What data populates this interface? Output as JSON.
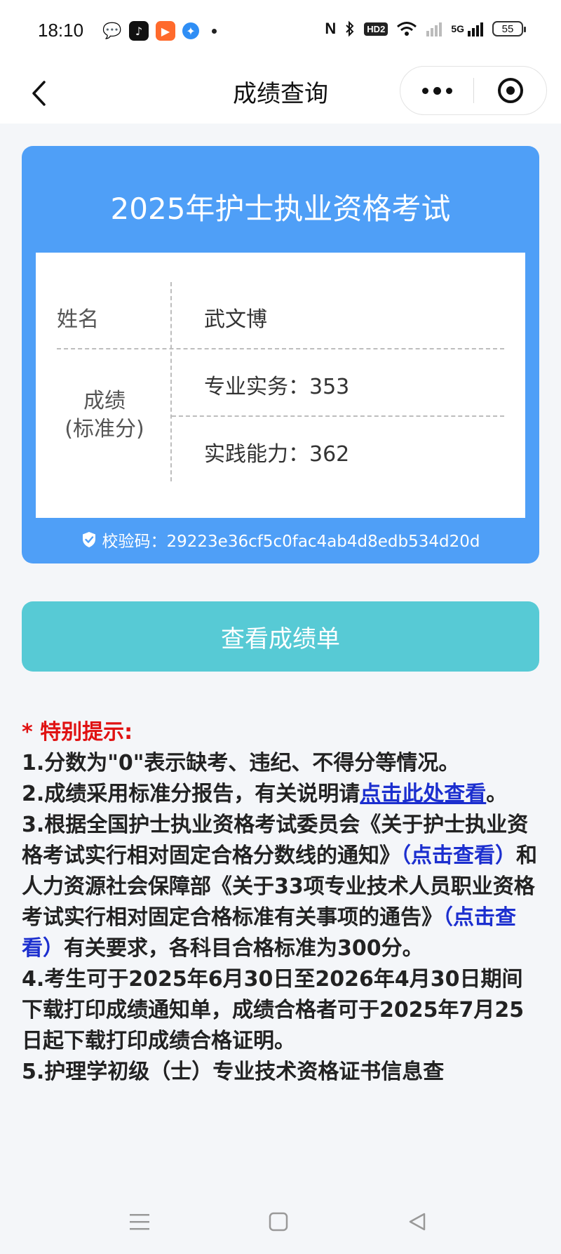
{
  "status_bar": {
    "time": "18:10",
    "battery": "55",
    "hd_label": "HD2",
    "network": "5G",
    "nfc": "N"
  },
  "nav": {
    "title": "成绩查询"
  },
  "card": {
    "title": "2025年护士执业资格考试",
    "name_label": "姓名",
    "name_value": "武文博",
    "score_label_line1": "成绩",
    "score_label_line2": "(标准分)",
    "scores": [
      "专业实务：353",
      "实践能力：362"
    ],
    "verify_text": "校验码：29223e36cf5c0fac4ab4d8edb534d20d"
  },
  "button": {
    "view_report": "查看成绩单"
  },
  "notice": {
    "heading": "* 特别提示:",
    "item1": "1.分数为\"0\"表示缺考、违纪、不得分等情况。",
    "item2_prefix": "2.成绩采用标准分报告，有关说明请",
    "item2_link": "点击此处查看",
    "item2_suffix": "。",
    "item3_part1": "3.根据全国护士执业资格考试委员会《关于护士执业资格考试实行相对固定合格分数线的通知》",
    "item3_link1": "（点击查看）",
    "item3_part2": "和人力资源社会保障部《关于33项专业技术人员职业资格考试实行相对固定合格标准有关事项的通告》",
    "item3_link2": "（点击查看）",
    "item3_part3": "有关要求，各科目合格标准为300分。",
    "item4": "4.考生可于2025年6月30日至2026年4月30日期间下载打印成绩通知单，成绩合格者可于2025年7月25日起下载打印成绩合格证明。",
    "item5": "5.护理学初级（士）专业技术资格证书信息查"
  },
  "colors": {
    "card_blue": "#4f9ff7",
    "button_teal": "#57cad5",
    "notice_red": "#e01212",
    "link_blue": "#1c2fcf"
  }
}
